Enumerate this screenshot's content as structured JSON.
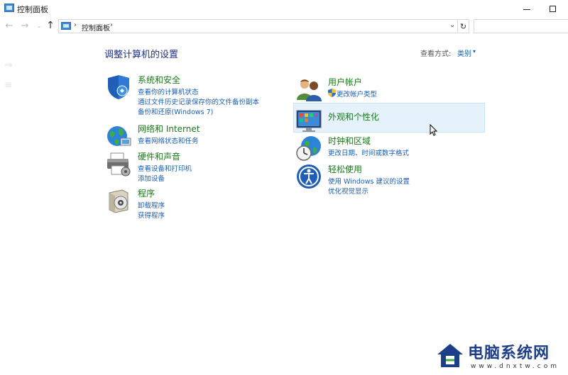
{
  "window": {
    "title": "控制面板",
    "minimize_label": "–",
    "maximize_label": "□"
  },
  "nav": {
    "back": "←",
    "forward": "→",
    "recent": "⌄",
    "up": "↑"
  },
  "address": {
    "separator": "›",
    "path": "控制面板",
    "dropdown": "⌄",
    "refresh": "↻"
  },
  "main": {
    "title": "调整计算机的设置",
    "view_by_label": "查看方式:",
    "view_by_value": "类别",
    "view_by_arrow": "▾"
  },
  "categories": [
    {
      "icon": "shield-icon",
      "title": "系统和安全",
      "links": [
        "查看你的计算机状态",
        "通过文件历史记录保存你的文件备份副本",
        "备份和还原(Windows 7)"
      ]
    },
    {
      "icon": "network-globe-icon",
      "title": "网络和 Internet",
      "links": [
        "查看网络状态和任务"
      ]
    },
    {
      "icon": "printer-icon",
      "title": "硬件和声音",
      "links": [
        "查看设备和打印机",
        "添加设备"
      ]
    },
    {
      "icon": "programs-disc-icon",
      "title": "程序",
      "links": [
        "卸载程序",
        "获得程序"
      ]
    },
    {
      "icon": "users-icon",
      "title": "用户帐户",
      "links": [
        "更改帐户类型"
      ]
    },
    {
      "icon": "display-icon",
      "title": "外观和个性化",
      "links": []
    },
    {
      "icon": "clock-globe-icon",
      "title": "时钟和区域",
      "links": [
        "更改日期、时间或数字格式"
      ]
    },
    {
      "icon": "ease-of-access-icon",
      "title": "轻松使用",
      "links": [
        "使用 Windows 建议的设置",
        "优化视觉显示"
      ]
    }
  ],
  "watermark": {
    "title": "电脑系统网",
    "subtitle": "www.dnxtw.com"
  },
  "colors": {
    "category_title": "#1a7a1a",
    "link": "#1a5fb4",
    "page_title": "#1e3287",
    "hover_bg": "#e5f1fb"
  }
}
